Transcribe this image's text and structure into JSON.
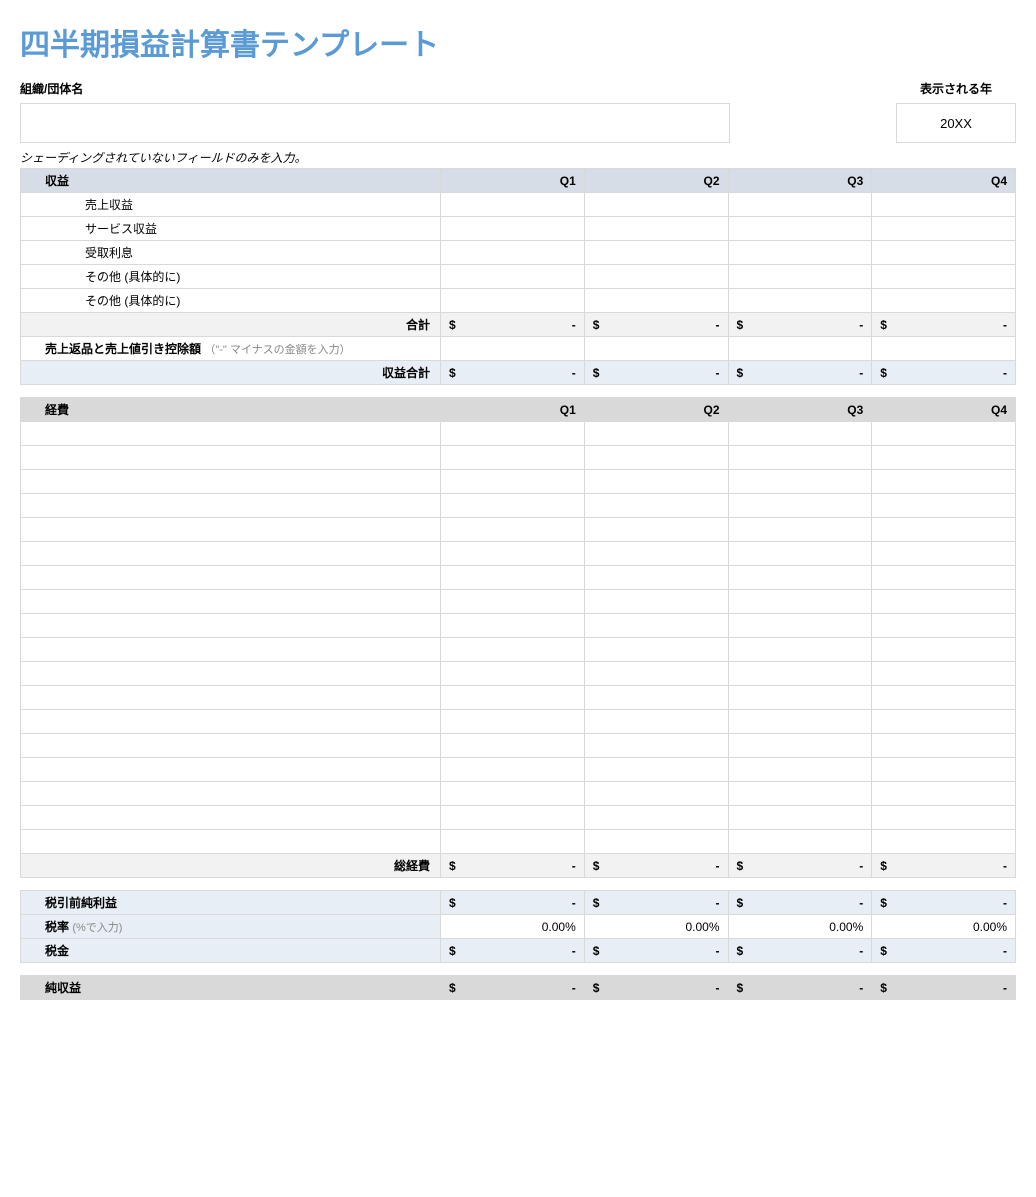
{
  "title": "四半期損益計算書テンプレート",
  "org_label": "組織/団体名",
  "year_label": "表示される年",
  "year_value": "20XX",
  "note": "シェーディングされていないフィールドのみを入力。",
  "quarters": [
    "Q1",
    "Q2",
    "Q3",
    "Q4"
  ],
  "revenue": {
    "header": "収益",
    "rows": [
      "売上収益",
      "サービス収益",
      "受取利息",
      "その他 (具体的に)",
      "その他 (具体的に)"
    ],
    "subtotal_label": "合計",
    "returns_label": "売上返品と売上値引き控除額",
    "returns_hint": "（\"-\" マイナスの金額を入力）",
    "total_label": "収益合計"
  },
  "expenses": {
    "header": "経費",
    "blank_rows": 18,
    "total_label": "総経費"
  },
  "summary": {
    "pretax_label": "税引前純利益",
    "taxrate_label": "税率",
    "taxrate_hint": "(%で入力)",
    "taxrate_value": "0.00%",
    "tax_label": "税金",
    "net_label": "純収益"
  },
  "money_symbol": "$",
  "money_dash": "-"
}
